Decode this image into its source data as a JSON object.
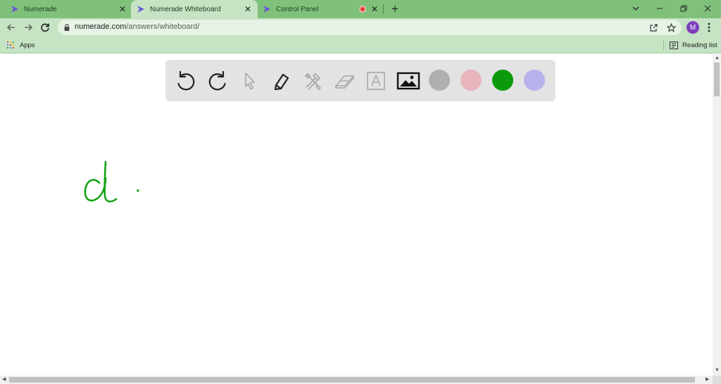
{
  "browser": {
    "tabs": [
      {
        "title": "Numerade",
        "favicon": "numerade-logo-icon",
        "active": false
      },
      {
        "title": "Numerade Whiteboard",
        "favicon": "numerade-logo-icon",
        "active": true
      },
      {
        "title": "Control Panel",
        "favicon": "numerade-logo-icon",
        "active": false,
        "recording": true
      }
    ],
    "url_host": "numerade.com",
    "url_path": "/answers/whiteboard/",
    "profile_initial": "M",
    "bookmarks": {
      "apps_label": "Apps",
      "reading_list_label": "Reading list"
    }
  },
  "whiteboard": {
    "tools": [
      {
        "name": "undo",
        "icon": "undo-icon",
        "enabled": true
      },
      {
        "name": "redo",
        "icon": "redo-icon",
        "enabled": true
      },
      {
        "name": "select",
        "icon": "cursor-icon",
        "enabled": false
      },
      {
        "name": "pen",
        "icon": "pen-icon",
        "enabled": true
      },
      {
        "name": "tools",
        "icon": "tools-icon",
        "enabled": false
      },
      {
        "name": "eraser",
        "icon": "eraser-icon",
        "enabled": false
      },
      {
        "name": "text",
        "icon": "text-icon",
        "enabled": false
      },
      {
        "name": "image",
        "icon": "image-icon",
        "enabled": true
      }
    ],
    "colors": [
      "#b0b0b0",
      "#e8b4bd",
      "#0b9a0b",
      "#b7b2ec"
    ],
    "selected_color": "#0b9a0b",
    "stroke_color": "#16a316"
  },
  "colors": {
    "tab_strip": "#7fc17b",
    "toolbar": "#c6e3c4",
    "logo_accent": "#6a56d8"
  }
}
